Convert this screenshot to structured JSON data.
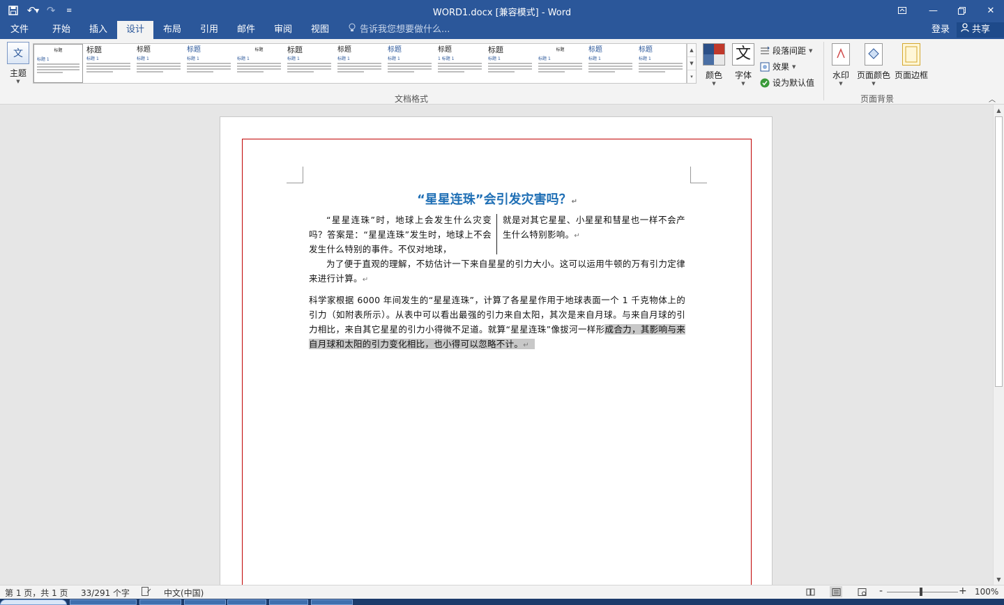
{
  "app": {
    "title": "WORD1.docx [兼容模式] - Word"
  },
  "qat": {
    "save_icon": "save-icon",
    "undo_icon": "undo-icon",
    "redo_icon": "redo-icon",
    "customize_icon": "customize-qat-icon"
  },
  "window_controls": {
    "ribbon_display_icon": "ribbon-display-icon",
    "minimize_icon": "minimize-icon",
    "restore_icon": "restore-icon",
    "close_icon": "close-icon"
  },
  "tabs": [
    {
      "label": "文件"
    },
    {
      "label": "开始"
    },
    {
      "label": "插入"
    },
    {
      "label": "设计"
    },
    {
      "label": "布局"
    },
    {
      "label": "引用"
    },
    {
      "label": "邮件"
    },
    {
      "label": "审阅"
    },
    {
      "label": "视图"
    }
  ],
  "active_tab": "设计",
  "tell_me": {
    "label": "告诉我您想要做什么..."
  },
  "account": {
    "login": "登录",
    "share": "共享"
  },
  "ribbon": {
    "theme_label": "主题",
    "gallery_items": [
      {
        "title": "标题",
        "heading": "标题 1"
      },
      {
        "title": "标题",
        "heading": "标题 1"
      },
      {
        "title": "标题",
        "heading": "标题 1"
      },
      {
        "title": "标题",
        "heading": "标题 1"
      },
      {
        "title": "标题",
        "heading": "标题 1"
      },
      {
        "title": "标题",
        "heading": "标题 1"
      },
      {
        "title": "标题",
        "heading": "标题 1"
      },
      {
        "title": "标题",
        "heading": "标题 1"
      },
      {
        "title": "标题",
        "heading": "1 标题 1"
      },
      {
        "title": "标题",
        "heading": "标题 1"
      },
      {
        "title": "标题",
        "heading": "标题 1"
      },
      {
        "title": "标题",
        "heading": "标题 1"
      },
      {
        "title": "标题",
        "heading": "标题 1"
      }
    ],
    "colors_label": "颜色",
    "fonts_label": "字体",
    "fonts_glyph": "文",
    "paragraph_spacing_label": "段落间距",
    "effects_label": "效果",
    "set_default_label": "设为默认值",
    "doc_format_group": "文档格式",
    "watermark_label": "水印",
    "page_color_label": "页面颜色",
    "page_borders_label": "页面边框",
    "page_background_group": "页面背景",
    "color_swatches": [
      "#2b4f87",
      "#c0392b",
      "#4a6fa5",
      "#e8e8e8"
    ]
  },
  "document": {
    "title": "“星星连珠”会引发灾害吗？",
    "col_left": "“星星连珠”时，地球上会发生什么灾变吗？答案是：“星星连珠”发生时，地球上不会发生什么特别的事件。不仅对地球，",
    "col_right": "就是对其它星星、小星星和彗星也一样不会产生什么特别影响。",
    "para2": "为了便于直观的理解，不妨估计一下来自星星的引力大小。这可以运用牛顿的万有引力定律来进行计算。",
    "para3_normal": "科学家根据 6000 年间发生的“星星连珠”，计算了各星星作用于地球表面一个 1 千克物体上的引力（如附表所示）。从表中可以看出最强的引力来自太阳，其次是来自月球。与来自月球的引力相比，来自其它星星的引力小得微不足道。就算“星星连珠”像拔河一样形",
    "para3_selected": "成合力，其影响与来自月球和太阳的引力变化相比，也小得可以忽略不计。",
    "para_mark": "↵"
  },
  "status": {
    "page": "第 1 页，共 1 页",
    "words": "33/291 个字",
    "language": "中文(中国)",
    "zoom": "100%",
    "zoom_minus": "-",
    "zoom_plus": "+",
    "zoom_level": 1.0
  },
  "colors": {
    "brand": "#2b579a",
    "title_blue": "#1f6fb5",
    "page_border": "#c00000",
    "selection": "#c8c8c8"
  }
}
